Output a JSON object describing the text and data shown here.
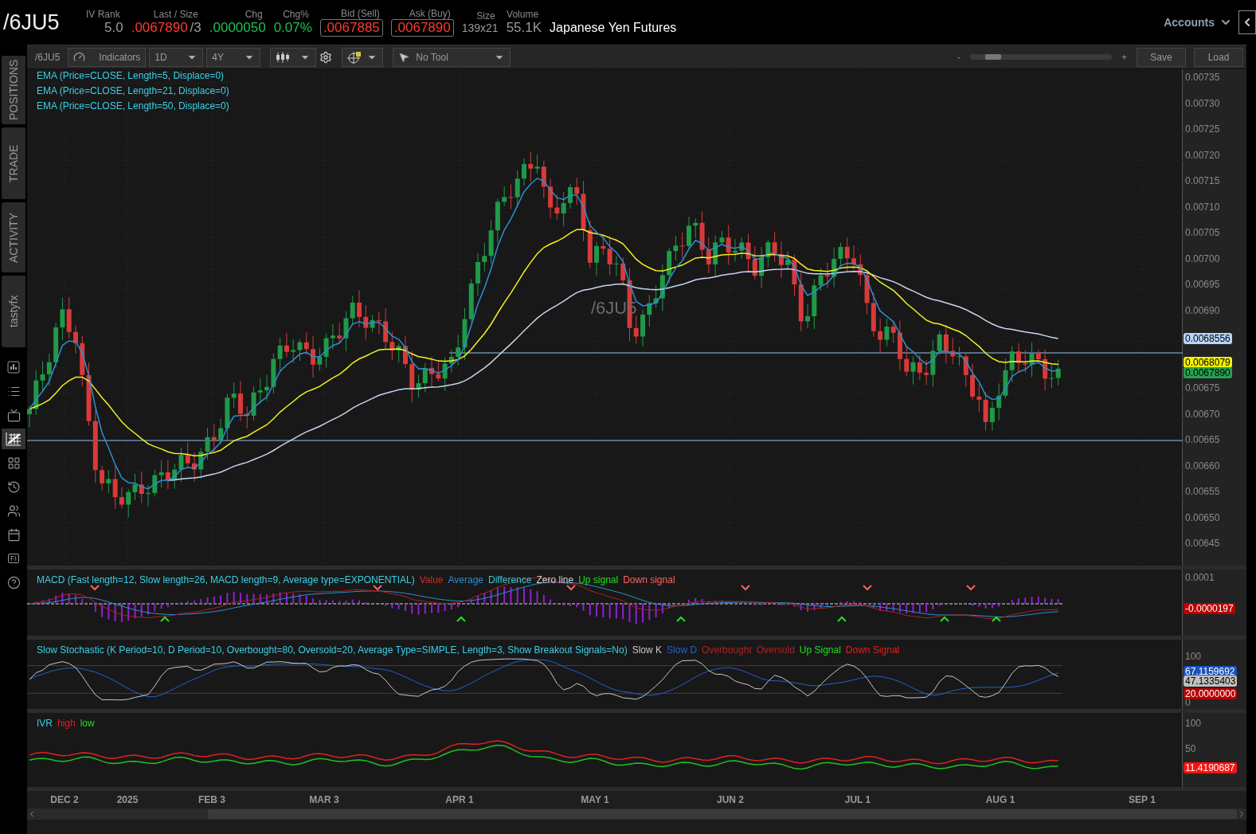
{
  "header": {
    "symbol": "/6JU5",
    "fields": [
      {
        "label": "IV Rank",
        "value": "5.0",
        "kind": "plain"
      },
      {
        "label": "Last / Size",
        "value": ".0067890",
        "extra": "/3",
        "kind": "down"
      },
      {
        "label": "Chg",
        "value": ".0000050",
        "kind": "up"
      },
      {
        "label": "Chg%",
        "value": "0.07%",
        "kind": "up"
      },
      {
        "label": "Bid (Sell)",
        "value": ".0067885",
        "kind": "boxed"
      },
      {
        "label": "Ask (Buy)",
        "value": ".0067890",
        "kind": "boxed"
      },
      {
        "label": "Size",
        "value": "139x21",
        "kind": "small"
      },
      {
        "label": "Volume",
        "value": "55.1K",
        "kind": "plain"
      }
    ],
    "description": "Japanese Yen Futures",
    "accounts": "Accounts"
  },
  "sidebar": {
    "tabs": [
      "POSITIONS",
      "TRADE",
      "ACTIVITY",
      "tastyfx"
    ],
    "icons": [
      {
        "kind": "bars",
        "selected": false
      },
      {
        "kind": "list",
        "selected": false
      },
      {
        "kind": "tv",
        "selected": false
      },
      {
        "kind": "chart",
        "selected": true
      },
      {
        "kind": "grid",
        "selected": false
      },
      {
        "kind": "history",
        "selected": false
      },
      {
        "kind": "people",
        "selected": false
      },
      {
        "kind": "calendar",
        "selected": false
      },
      {
        "kind": "text",
        "label": "FI",
        "selected": false
      },
      {
        "kind": "help",
        "selected": false
      }
    ]
  },
  "toolbar": {
    "symbol": "/6JU5",
    "indicators": "Indicators",
    "aggregation": "1D",
    "range": "4Y",
    "tool": "No Tool",
    "zoom_minus": "-",
    "zoom_plus": "+",
    "zoom": {
      "level": 0.12
    },
    "save": "Save",
    "load": "Load"
  },
  "price_pane": {
    "studies": [
      "EMA (Price=CLOSE, Length=5, Displace=0)",
      "EMA (Price=CLOSE, Length=21, Displace=0)",
      "EMA (Price=CLOSE, Length=50, Displace=0)"
    ],
    "watermark": "/6JU5",
    "ticks": [
      "0.00735",
      "0.00730",
      "0.00725",
      "0.00720",
      "0.00715",
      "0.00710",
      "0.00705",
      "0.00700",
      "0.00695",
      "0.00690",
      "0.00675",
      "0.00670",
      "0.00665",
      "0.00660",
      "0.00655",
      "0.00650",
      "0.00645"
    ],
    "labels": [
      {
        "text": "0.0068556",
        "color": "#b8d4f8"
      },
      {
        "text": "0.0068079",
        "color": "#f2f200"
      },
      {
        "text": "0.0067890",
        "color": "#28a050"
      }
    ]
  },
  "macd": {
    "title": "MACD (Fast length=12, Slow length=26, MACD length=9, Average type=EXPONENTIAL)",
    "legend": [
      {
        "text": "Value",
        "color": "#c8302a"
      },
      {
        "text": "Average",
        "color": "#2a8fd0"
      },
      {
        "text": "Difference",
        "color": "#3fc8d8"
      },
      {
        "text": "Zero line",
        "color": "#d0d0d0"
      },
      {
        "text": "Up signal",
        "color": "#20e020"
      },
      {
        "text": "Down signal",
        "color": "#ff6060"
      }
    ],
    "ticks": [
      "0.0001"
    ],
    "labels": [
      {
        "text": "-0.0000197",
        "color": "#b80000"
      }
    ]
  },
  "stochastic": {
    "title": "Slow Stochastic (K Period=10, D Period=10, Overbought=80, Oversold=20, Average Type=SIMPLE, Length=3, Show Breakout Signals=No)",
    "legend": [
      {
        "text": "Slow K",
        "color": "#c8c8c8"
      },
      {
        "text": "Slow D",
        "color": "#2060d0"
      },
      {
        "text": "Overbought",
        "color": "#b02020"
      },
      {
        "text": "Oversold",
        "color": "#b02020"
      },
      {
        "text": "Up Signal",
        "color": "#20e020"
      },
      {
        "text": "Down Signal",
        "color": "#e02020"
      }
    ],
    "ticks": [
      "100",
      "0"
    ],
    "labels": [
      {
        "text": "67.1159692",
        "color": "#1a50b8"
      },
      {
        "text": "47.1335403",
        "color": "#c0c0c0"
      },
      {
        "text": "20.0000000",
        "color": "#b80000"
      }
    ]
  },
  "ivr": {
    "title": "IVR",
    "legend": [
      {
        "text": "high",
        "color": "#e02020"
      },
      {
        "text": "low",
        "color": "#20e020"
      }
    ],
    "ticks": [
      "100",
      "50"
    ],
    "labels": [
      {
        "text": "11.4190687",
        "color": "#ff1010"
      }
    ]
  },
  "x_axis": [
    "DEC 2",
    "2025",
    "FEB 3",
    "MAR 3",
    "APR 1",
    "MAY 1",
    "JUN 2",
    "JUL 1",
    "AUG 1",
    "SEP 1"
  ]
}
